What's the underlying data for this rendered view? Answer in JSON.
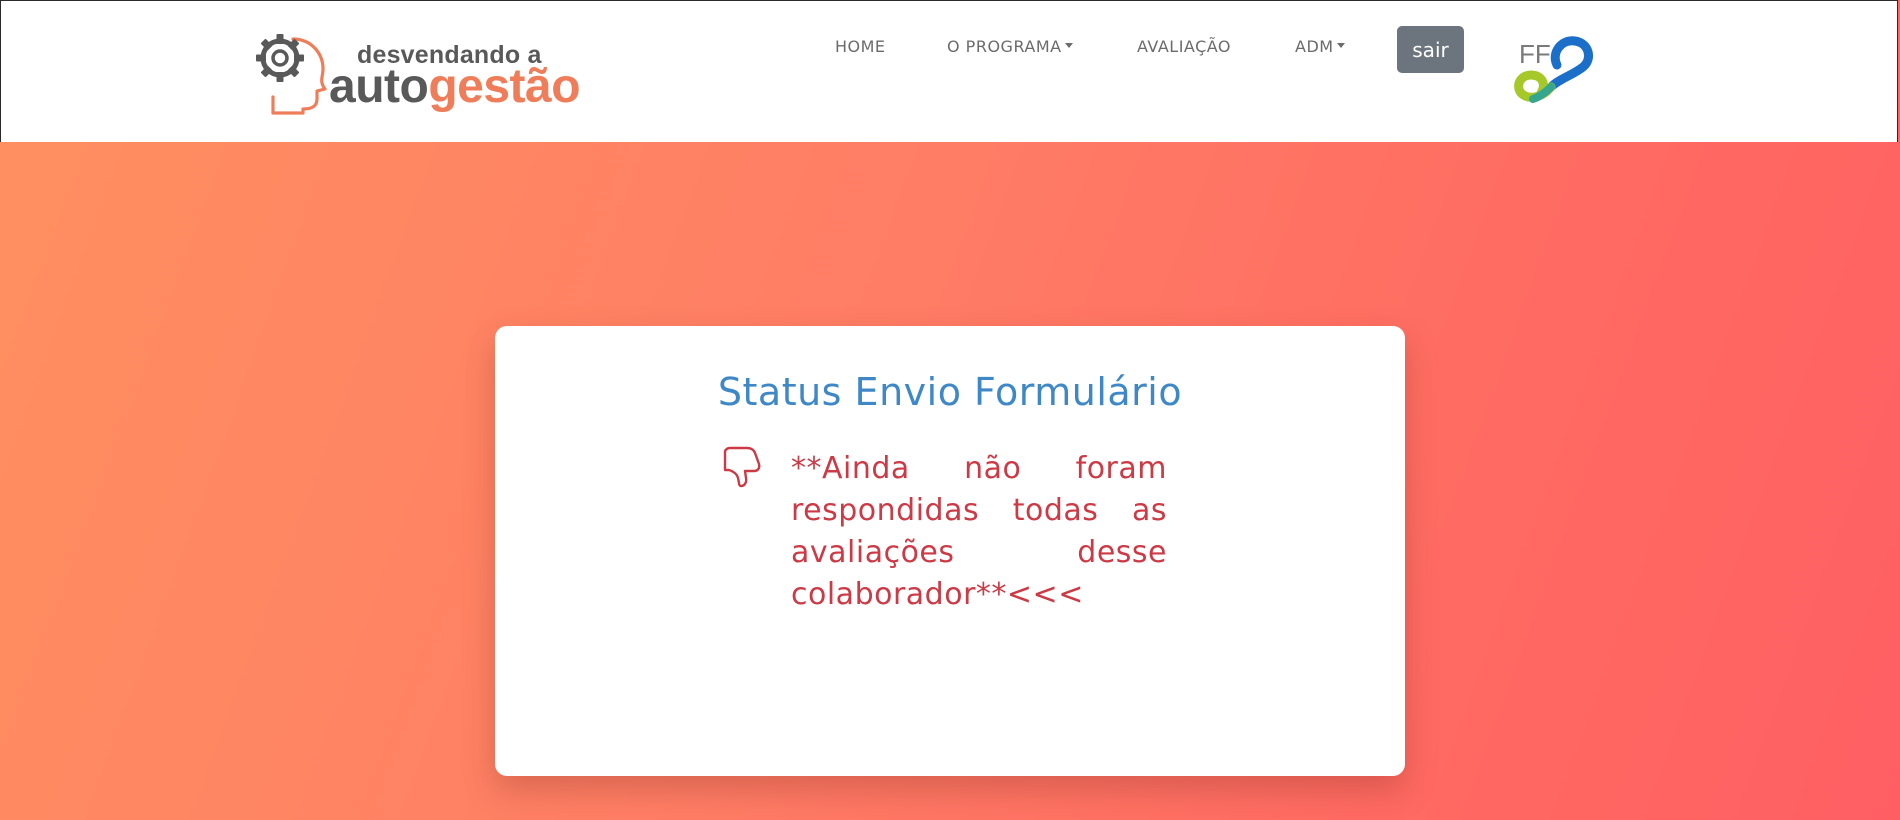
{
  "header": {
    "logo": {
      "line1": "desvendando a",
      "line2_part1": "auto",
      "line2_part2": "gestão",
      "icon": "gear-head-icon",
      "colors": {
        "gray": "#595959",
        "accent": "#f07d5a"
      }
    },
    "nav": [
      {
        "label": "HOME",
        "dropdown": false
      },
      {
        "label": "O PROGRAMA",
        "dropdown": true
      },
      {
        "label": "AVALIAÇÃO",
        "dropdown": false
      },
      {
        "label": "ADM",
        "dropdown": true
      }
    ],
    "logout_label": "sair",
    "partner_logo": {
      "text": "FF",
      "icon": "ff-infinity-logo"
    }
  },
  "card": {
    "title": "Status Envio Formulário",
    "message": "**Ainda não foram respondidas todas as avaliações desse colaborador**<<<",
    "icon": "thumbs-down-icon"
  },
  "colors": {
    "title": "#3f88c8",
    "message": "#cc3a46",
    "button": "#6c757d",
    "background_start": "#ff9060",
    "background_end": "#ff5f63"
  }
}
